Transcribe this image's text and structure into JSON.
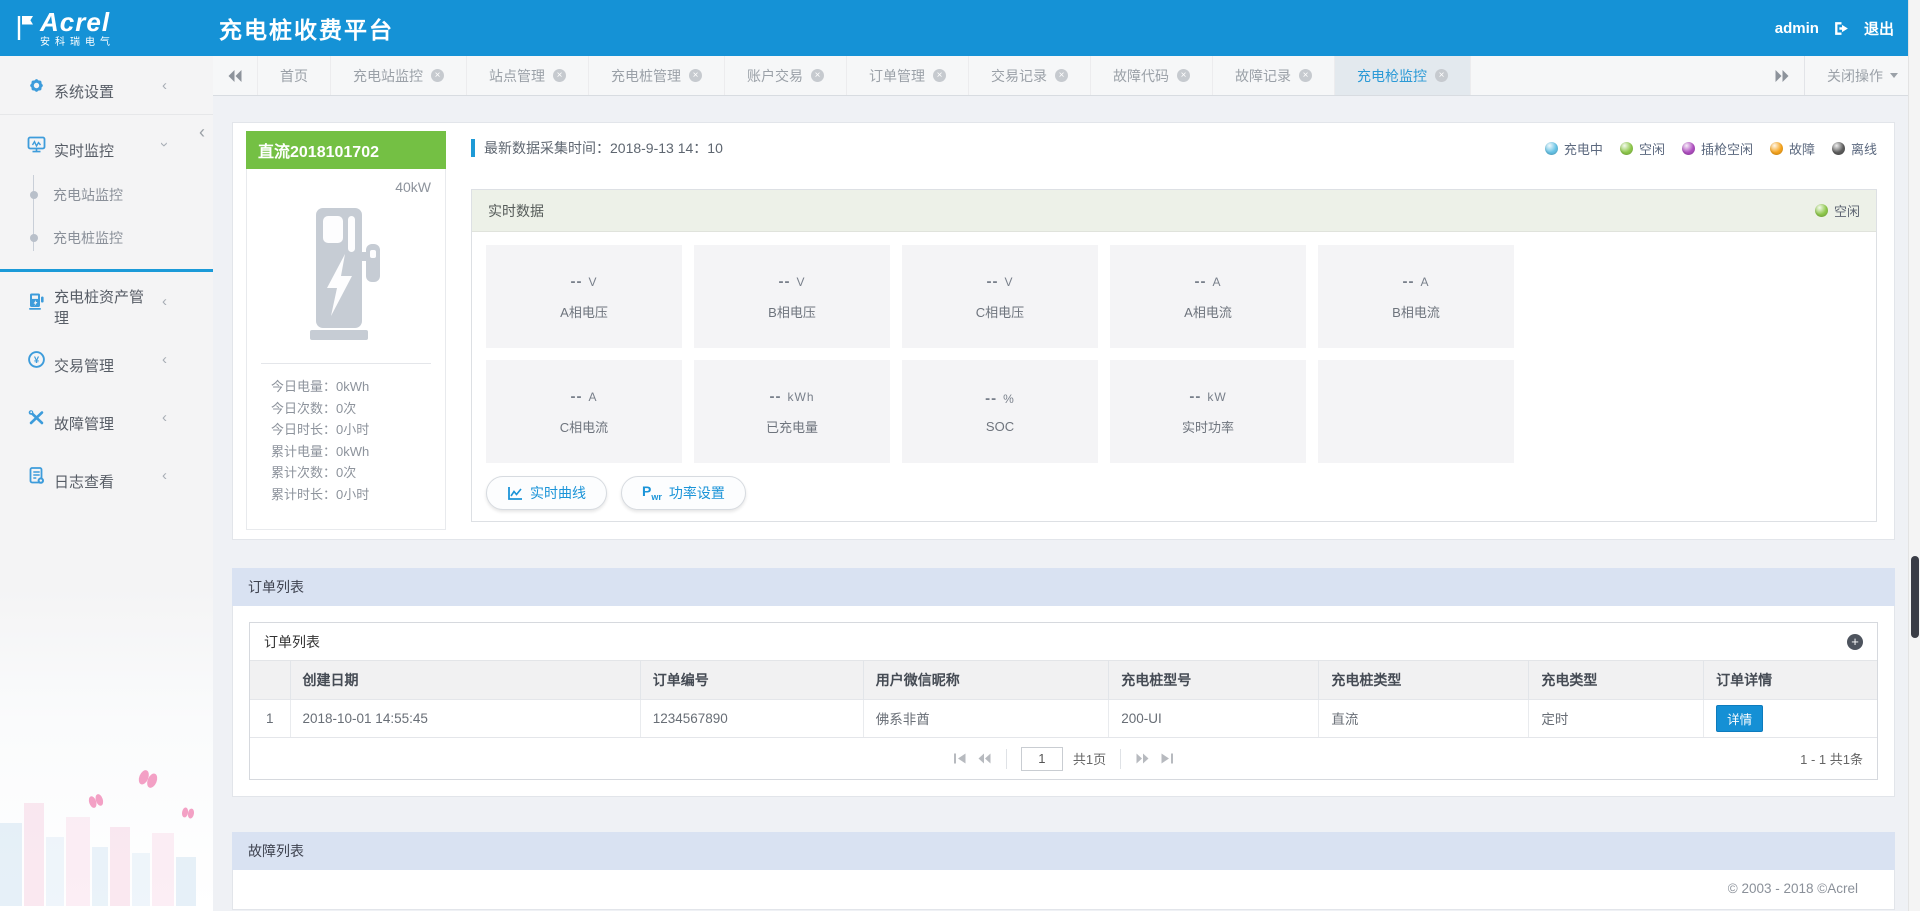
{
  "colors": {
    "brand_blue": "#1592d6",
    "card_header_green": "#74c044",
    "section_bar_blue": "#d9e2f2",
    "status_charging": "#66c3e6",
    "status_idle": "#8ec84b",
    "status_plugged_idle": "#af4fc0",
    "status_fault": "#f6a41d",
    "status_offline": "#5c5c5c"
  },
  "header": {
    "logo_text": "Acrel",
    "logo_subtext": "安科瑞电气",
    "title": "充电桩收费平台",
    "username": "admin",
    "logout_label": "退出"
  },
  "sidebar": {
    "items": [
      {
        "label": "系统设置",
        "icon": "gear",
        "expanded": false
      },
      {
        "label": "实时监控",
        "icon": "monitor",
        "expanded": true,
        "children": [
          "充电站监控",
          "充电桩监控"
        ]
      },
      {
        "label": "充电桩资产管理",
        "icon": "charger",
        "expanded": false
      },
      {
        "label": "交易管理",
        "icon": "transaction",
        "expanded": false
      },
      {
        "label": "故障管理",
        "icon": "tools",
        "expanded": false
      },
      {
        "label": "日志查看",
        "icon": "log",
        "expanded": false
      }
    ]
  },
  "tabbar": {
    "tabs": [
      {
        "label": "首页",
        "closable": false,
        "active": false
      },
      {
        "label": "充电站监控",
        "closable": true,
        "active": false
      },
      {
        "label": "站点管理",
        "closable": true,
        "active": false
      },
      {
        "label": "充电桩管理",
        "closable": true,
        "active": false
      },
      {
        "label": "账户交易",
        "closable": true,
        "active": false
      },
      {
        "label": "订单管理",
        "closable": true,
        "active": false
      },
      {
        "label": "交易记录",
        "closable": true,
        "active": false
      },
      {
        "label": "故障代码",
        "closable": true,
        "active": false
      },
      {
        "label": "故障记录",
        "closable": true,
        "active": false
      },
      {
        "label": "充电枪监控",
        "closable": true,
        "active": true
      }
    ],
    "close_menu_label": "关闭操作"
  },
  "gun_card": {
    "title": "直流2018101702",
    "power": "40kW",
    "stats": [
      {
        "label": "今日电量：",
        "value": "0kWh"
      },
      {
        "label": "今日次数：",
        "value": "0次"
      },
      {
        "label": "今日时长：",
        "value": "0小时"
      },
      {
        "label": "累计电量：",
        "value": "0kWh"
      },
      {
        "label": "累计次数：",
        "value": "0次"
      },
      {
        "label": "累计时长：",
        "value": "0小时"
      }
    ]
  },
  "monitor": {
    "capture_time": "最新数据采集时间：2018-9-13 14：10",
    "legend": [
      {
        "label": "充电中",
        "color": "#66c3e6"
      },
      {
        "label": "空闲",
        "color": "#8ec84b"
      },
      {
        "label": "插枪空闲",
        "color": "#af4fc0"
      },
      {
        "label": "故障",
        "color": "#f6a41d"
      },
      {
        "label": "离线",
        "color": "#5c5c5c"
      }
    ],
    "realtime": {
      "title": "实时数据",
      "status": {
        "label": "空闲",
        "color": "#8ec84b"
      },
      "metrics": [
        {
          "value": "--",
          "unit": "V",
          "label": "A相电压"
        },
        {
          "value": "--",
          "unit": "V",
          "label": "B相电压"
        },
        {
          "value": "--",
          "unit": "V",
          "label": "C相电压"
        },
        {
          "value": "--",
          "unit": "A",
          "label": "A相电流"
        },
        {
          "value": "--",
          "unit": "A",
          "label": "B相电流"
        },
        {
          "value": "--",
          "unit": "A",
          "label": "C相电流"
        },
        {
          "value": "--",
          "unit": "kWh",
          "label": "已充电量"
        },
        {
          "value": "--",
          "unit": "%",
          "label": "SOC"
        },
        {
          "value": "--",
          "unit": "kW",
          "label": "实时功率"
        },
        {
          "value": "",
          "unit": "",
          "label": ""
        }
      ],
      "buttons": [
        {
          "label": "实时曲线"
        },
        {
          "label": "功率设置"
        }
      ]
    }
  },
  "order_section": {
    "bar_title": "订单列表",
    "panel_title": "订单列表",
    "table": {
      "columns": [
        "创建日期",
        "订单编号",
        "用户微信昵称",
        "充电桩型号",
        "充电桩类型",
        "充电类型",
        "订单详情"
      ],
      "rows": [
        {
          "index": "1",
          "cells": [
            "2018-10-01 14:55:45",
            "1234567890",
            "佛系非酋",
            "200-UI",
            "直流",
            "定时"
          ],
          "action": "详情"
        }
      ]
    },
    "pagination": {
      "page": "1",
      "pages_label": "共1页",
      "range_label": "1 - 1  共1条"
    }
  },
  "fault_section": {
    "bar_title": "故障列表"
  },
  "footer": {
    "copyright": "© 2003 - 2018 ©Acrel"
  }
}
